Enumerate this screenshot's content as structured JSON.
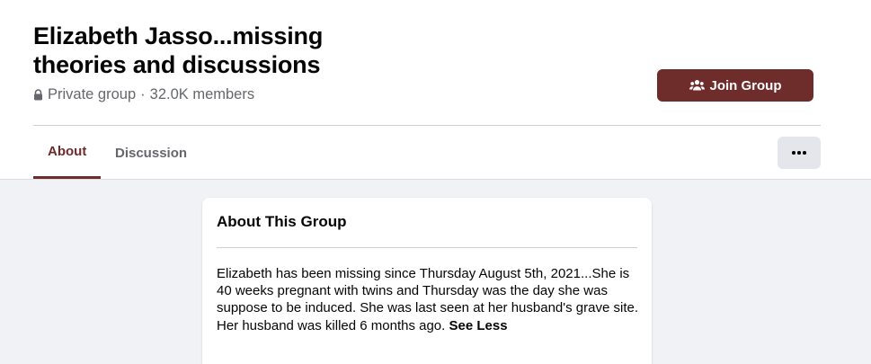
{
  "group": {
    "title": "Elizabeth Jasso...missing theories and discussions",
    "privacy": "Private group",
    "separator": "·",
    "members": "32.0K members",
    "join_label": "Join Group"
  },
  "tabs": [
    {
      "label": "About",
      "active": true
    },
    {
      "label": "Discussion",
      "active": false
    }
  ],
  "about_card": {
    "title": "About This Group",
    "description_line1": "Elizabeth has been missing since Thursday August 5th, 2021...She is 40 weeks pregnant with twins and Thursday was the day she was suppose to be induced. She was last seen at her husband's grave site.",
    "description_line2": "Her husband was killed 6 months ago. ",
    "see_less": "See Less"
  },
  "icons": {
    "privacy": "lock-icon",
    "join": "people-icon",
    "more": "more-icon"
  },
  "colors": {
    "accent": "#6e2c2b",
    "secondary_text": "#65676b",
    "page_background": "#f0f2f5",
    "button_gray": "#e4e6eb"
  }
}
